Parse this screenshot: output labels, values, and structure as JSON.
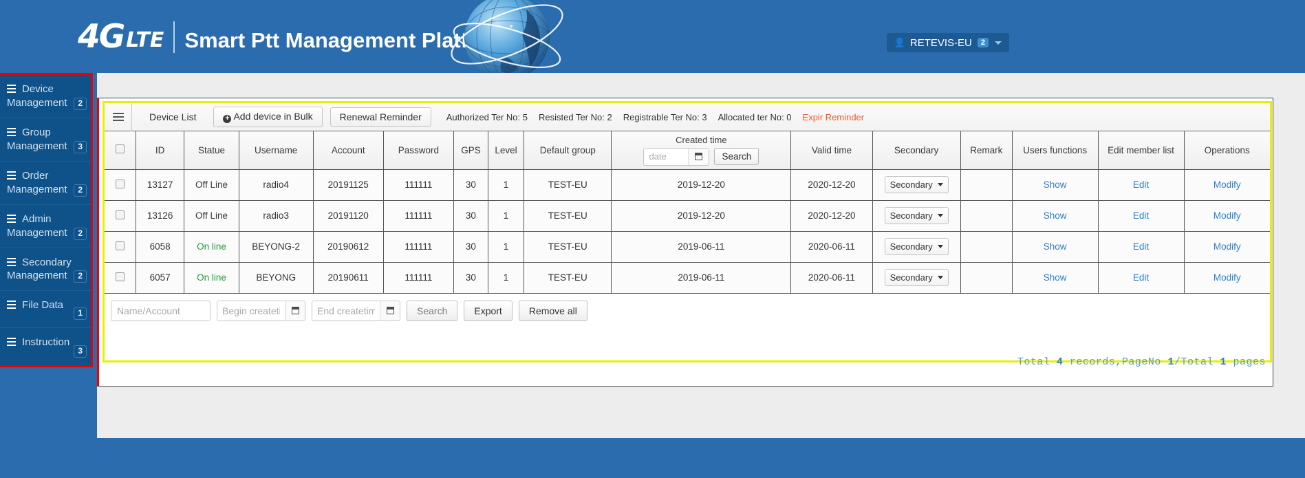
{
  "header": {
    "logo_4g": "4G",
    "logo_lte": "LTE",
    "title": "Smart Ptt Management Platform",
    "globe_icon": "globe-icon",
    "user": {
      "icon": "user-icon",
      "name": "RETEVIS-EU",
      "badge": "2",
      "caret_icon": "chevron-down-icon"
    }
  },
  "sidebar": {
    "items": [
      {
        "icon": "list-icon",
        "label": "Device Management",
        "badge": "2",
        "key": "device-management"
      },
      {
        "icon": "list-icon",
        "label": "Group Management",
        "badge": "3",
        "key": "group-management"
      },
      {
        "icon": "list-icon",
        "label": "Order Management",
        "badge": "2",
        "key": "order-management"
      },
      {
        "icon": "list-icon",
        "label": "Admin Management",
        "badge": "2",
        "key": "admin-management"
      },
      {
        "icon": "list-icon",
        "label": "Secondary Management",
        "badge": "2",
        "key": "secondary-management"
      },
      {
        "icon": "list-icon",
        "label": "File Data",
        "badge": "1",
        "key": "file-data"
      },
      {
        "icon": "list-icon",
        "label": "Instruction",
        "badge": "3",
        "key": "instruction"
      }
    ]
  },
  "toolbar": {
    "burger_icon": "hamburger-menu-icon",
    "device_list_label": "Device List",
    "add_bulk_label": "Add device in Bulk",
    "add_bulk_icon": "plus-circle-icon",
    "renewal_label": "Renewal Reminder",
    "stats": [
      "Authorized Ter No: 5",
      "Resisted Ter No: 2",
      "Registrable Ter No: 3",
      "Allocated ter No: 0"
    ],
    "expire_label": "Expir Reminder"
  },
  "table": {
    "columns": [
      "",
      "ID",
      "Statue",
      "Username",
      "Account",
      "Password",
      "GPS",
      "Level",
      "Default group",
      "Created time",
      "Valid time",
      "Secondary",
      "Remark",
      "Users functions",
      "Edit member list",
      "Operations"
    ],
    "created_time_header": {
      "title": "Created time",
      "date_placeholder": "date",
      "calendar_icon": "calendar-icon",
      "search_label": "Search"
    },
    "rows": [
      {
        "id": "13127",
        "statue": "Off Line",
        "online": false,
        "username": "radio4",
        "account": "20191125",
        "password": "111111",
        "gps": "30",
        "level": "1",
        "group": "TEST-EU",
        "created": "2019-12-20",
        "valid": "2020-12-20",
        "secondary": "Secondary",
        "remark": "",
        "users_fn": "Show",
        "edit_member": "Edit",
        "operations": "Modify"
      },
      {
        "id": "13126",
        "statue": "Off Line",
        "online": false,
        "username": "radio3",
        "account": "20191120",
        "password": "111111",
        "gps": "30",
        "level": "1",
        "group": "TEST-EU",
        "created": "2019-12-20",
        "valid": "2020-12-20",
        "secondary": "Secondary",
        "remark": "",
        "users_fn": "Show",
        "edit_member": "Edit",
        "operations": "Modify"
      },
      {
        "id": "6058",
        "statue": "On line",
        "online": true,
        "username": "BEYONG-2",
        "account": "20190612",
        "password": "111111",
        "gps": "30",
        "level": "1",
        "group": "TEST-EU",
        "created": "2019-06-11",
        "valid": "2020-06-11",
        "secondary": "Secondary",
        "remark": "",
        "users_fn": "Show",
        "edit_member": "Edit",
        "operations": "Modify"
      },
      {
        "id": "6057",
        "statue": "On line",
        "online": true,
        "username": "BEYONG",
        "account": "20190611",
        "password": "111111",
        "gps": "30",
        "level": "1",
        "group": "TEST-EU",
        "created": "2019-06-11",
        "valid": "2020-06-11",
        "secondary": "Secondary",
        "remark": "",
        "users_fn": "Show",
        "edit_member": "Edit",
        "operations": "Modify"
      }
    ]
  },
  "bottombar": {
    "name_account_placeholder": "Name/Account",
    "begin_placeholder": "Begin createtime",
    "end_placeholder": "End createtime",
    "calendar_icon": "calendar-icon",
    "search_label": "Search",
    "export_label": "Export",
    "remove_all_label": "Remove all"
  },
  "pager": {
    "prefix": "Total ",
    "total_records": "4",
    "mid": " records,PageNo ",
    "page_no": "1",
    "slash": "/Total ",
    "total_pages": "1",
    "suffix": " pages"
  },
  "colors": {
    "brand_blue": "#2a6cad",
    "sidebar_blue": "#0f5189",
    "highlight_red": "#ee0000",
    "highlight_yellow": "#e8f000",
    "online_green": "#1f9d3d",
    "link_blue": "#2f7ec4",
    "expire_orange": "#f05a28"
  }
}
